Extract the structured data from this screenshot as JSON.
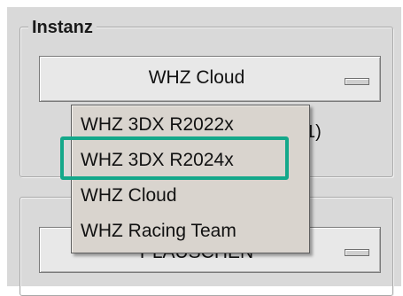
{
  "group_top": {
    "title": "Instanz"
  },
  "instance_select": {
    "value": "WHZ Cloud"
  },
  "partial_text": "1)",
  "second_button": {
    "label": "PLAUSCHEN"
  },
  "dropdown": {
    "items": [
      {
        "label": "WHZ 3DX R2022x"
      },
      {
        "label": "WHZ 3DX R2024x"
      },
      {
        "label": "WHZ Cloud"
      },
      {
        "label": "WHZ Racing Team"
      }
    ],
    "highlighted_index": 1
  },
  "colors": {
    "panel_bg": "#d9d9d9",
    "menu_bg": "#d9d4ce",
    "highlight": "#14a88a"
  }
}
